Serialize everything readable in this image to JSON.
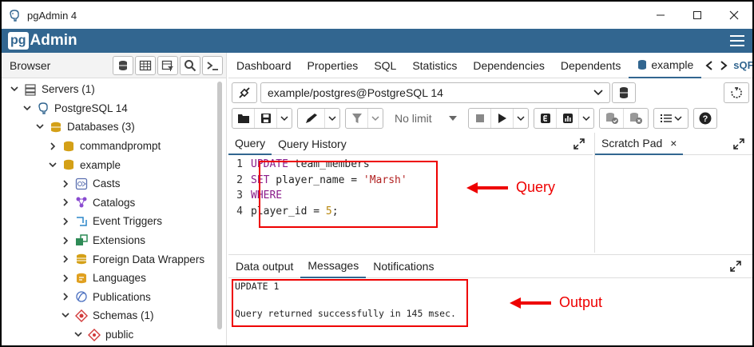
{
  "window": {
    "title": "pgAdmin 4",
    "brand": {
      "logo_pg": "pg",
      "logo_admin": "Admin",
      "color": "#326690"
    }
  },
  "browser": {
    "title": "Browser",
    "tree": [
      {
        "label": "Servers (1)",
        "depth": 0,
        "expanded": true,
        "icon": "server-group-icon"
      },
      {
        "label": "PostgreSQL 14",
        "depth": 1,
        "expanded": true,
        "icon": "elephant-icon"
      },
      {
        "label": "Databases (3)",
        "depth": 2,
        "expanded": true,
        "icon": "database-group-icon"
      },
      {
        "label": "commandprompt",
        "depth": 3,
        "expanded": false,
        "icon": "database-icon"
      },
      {
        "label": "example",
        "depth": 3,
        "expanded": true,
        "icon": "database-icon"
      },
      {
        "label": "Casts",
        "depth": 4,
        "expanded": false,
        "icon": "cast-icon"
      },
      {
        "label": "Catalogs",
        "depth": 4,
        "expanded": false,
        "icon": "catalog-icon"
      },
      {
        "label": "Event Triggers",
        "depth": 4,
        "expanded": false,
        "icon": "event-trigger-icon"
      },
      {
        "label": "Extensions",
        "depth": 4,
        "expanded": false,
        "icon": "extension-icon"
      },
      {
        "label": "Foreign Data Wrappers",
        "depth": 4,
        "expanded": false,
        "icon": "fdw-icon"
      },
      {
        "label": "Languages",
        "depth": 4,
        "expanded": false,
        "icon": "language-icon"
      },
      {
        "label": "Publications",
        "depth": 4,
        "expanded": false,
        "icon": "publication-icon"
      },
      {
        "label": "Schemas (1)",
        "depth": 4,
        "expanded": true,
        "icon": "schema-icon"
      },
      {
        "label": "public",
        "depth": 5,
        "expanded": true,
        "icon": "schema-public-icon"
      }
    ]
  },
  "tabs": [
    "Dashboard",
    "Properties",
    "SQL",
    "Statistics",
    "Dependencies",
    "Dependents",
    "example"
  ],
  "tabs_truncated": "sQF",
  "connection": {
    "value": "example/postgres@PostgreSQL 14"
  },
  "toolbar": {
    "limit": "No limit"
  },
  "editor_tabs": {
    "query": "Query",
    "history": "Query History"
  },
  "scratch": {
    "title": "Scratch Pad",
    "close": "×"
  },
  "code": {
    "line_numbers": [
      "1",
      "2",
      "3",
      "4"
    ],
    "l1_kw": "UPDATE",
    "l1_rest": " team_members",
    "l2_kw": "SET",
    "l2_rest": " player_name = ",
    "l2_str": "'Marsh'",
    "l3_kw": "WHERE",
    "l4_rest": "player_id = ",
    "l4_num": "5",
    "l4_end": ";"
  },
  "output_tabs": [
    "Data output",
    "Messages",
    "Notifications"
  ],
  "output": {
    "line1": "UPDATE 1",
    "line2": "",
    "line3": "Query returned successfully in 145 msec."
  },
  "annotations": {
    "query": "Query",
    "output": "Output",
    "color": "#e00000"
  }
}
